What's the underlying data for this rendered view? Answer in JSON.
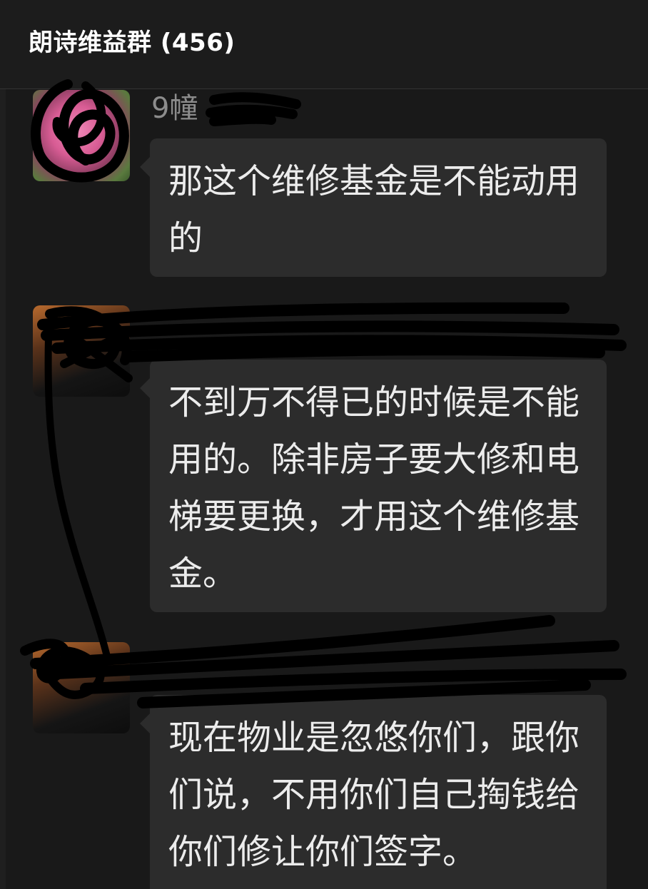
{
  "chat": {
    "title": "朗诗维益群 (456)",
    "messages": [
      {
        "sender": "9幢",
        "avatar_icon": "flower-avatar-icon",
        "text": "那这个维修基金是不能动用的"
      },
      {
        "sender": "",
        "avatar_icon": "user-avatar-icon",
        "text": "不到万不得已的时候是不能用的。除非房子要大修和电梯要更换，才用这个维修基金。"
      },
      {
        "sender": "",
        "avatar_icon": "user-avatar-icon",
        "text": "现在物业是忽悠你们，跟你们说，不用你们自己掏钱给你们修让你们签字。"
      }
    ]
  },
  "colors": {
    "background": "#191919",
    "bubble": "#2c2c2c",
    "text": "#ececec",
    "sender": "#8c8c8c",
    "redaction": "#000000"
  }
}
